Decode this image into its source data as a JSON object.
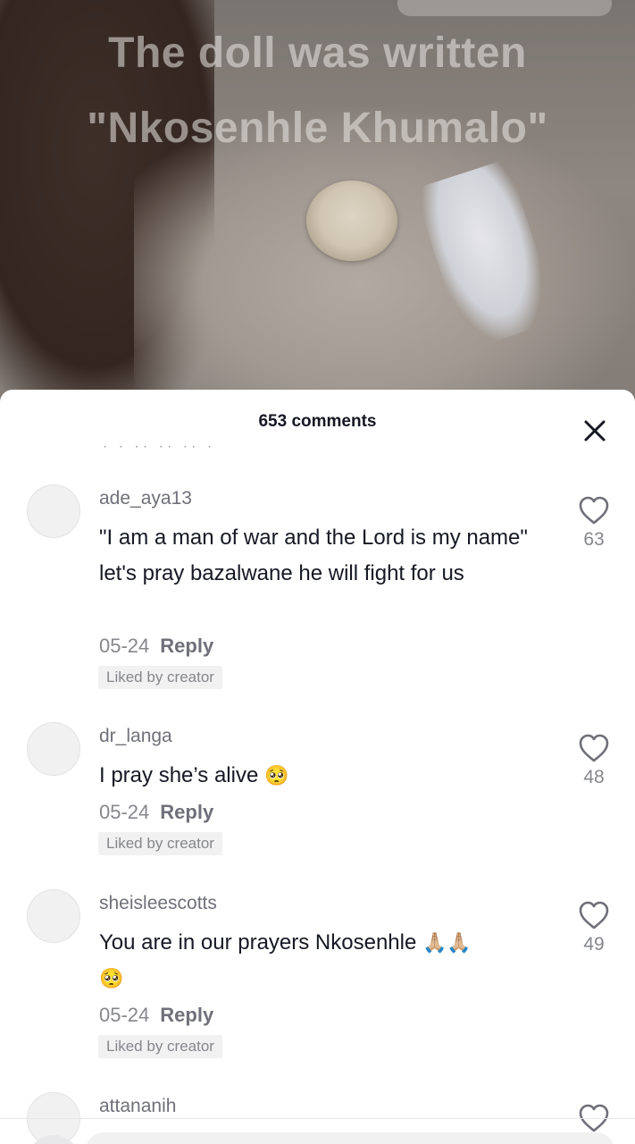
{
  "video": {
    "caption_line1": "The doll was written",
    "caption_line2": "\"Nkosenhle Khumalo\""
  },
  "sheet": {
    "comment_count": "653 comments",
    "close_icon": "close-icon"
  },
  "comments": [
    {
      "username": "ade_aya13",
      "text": "\"I am a man of war and the Lord is my name\" let's pray bazalwane he will fight for us",
      "date": "05-24",
      "reply_label": "Reply",
      "liked_badge": "Liked by creator",
      "likes": "63"
    },
    {
      "username": "dr_langa",
      "text": "I pray she’s alive",
      "emoji": "🥺",
      "date": "05-24",
      "reply_label": "Reply",
      "liked_badge": "Liked by creator",
      "likes": "48"
    },
    {
      "username": "sheisleescotts",
      "text": "You are in our prayers Nkosenhle",
      "emoji_inline": "🙏🏼🙏🏼",
      "emoji_next_line": "🥺",
      "date": "05-24",
      "reply_label": "Reply",
      "liked_badge": "Liked by creator",
      "likes": "49"
    },
    {
      "username": "attananih"
    }
  ],
  "colors": {
    "text_primary": "#161823",
    "text_secondary": "#86878b",
    "badge_bg": "#f1f1f2"
  }
}
